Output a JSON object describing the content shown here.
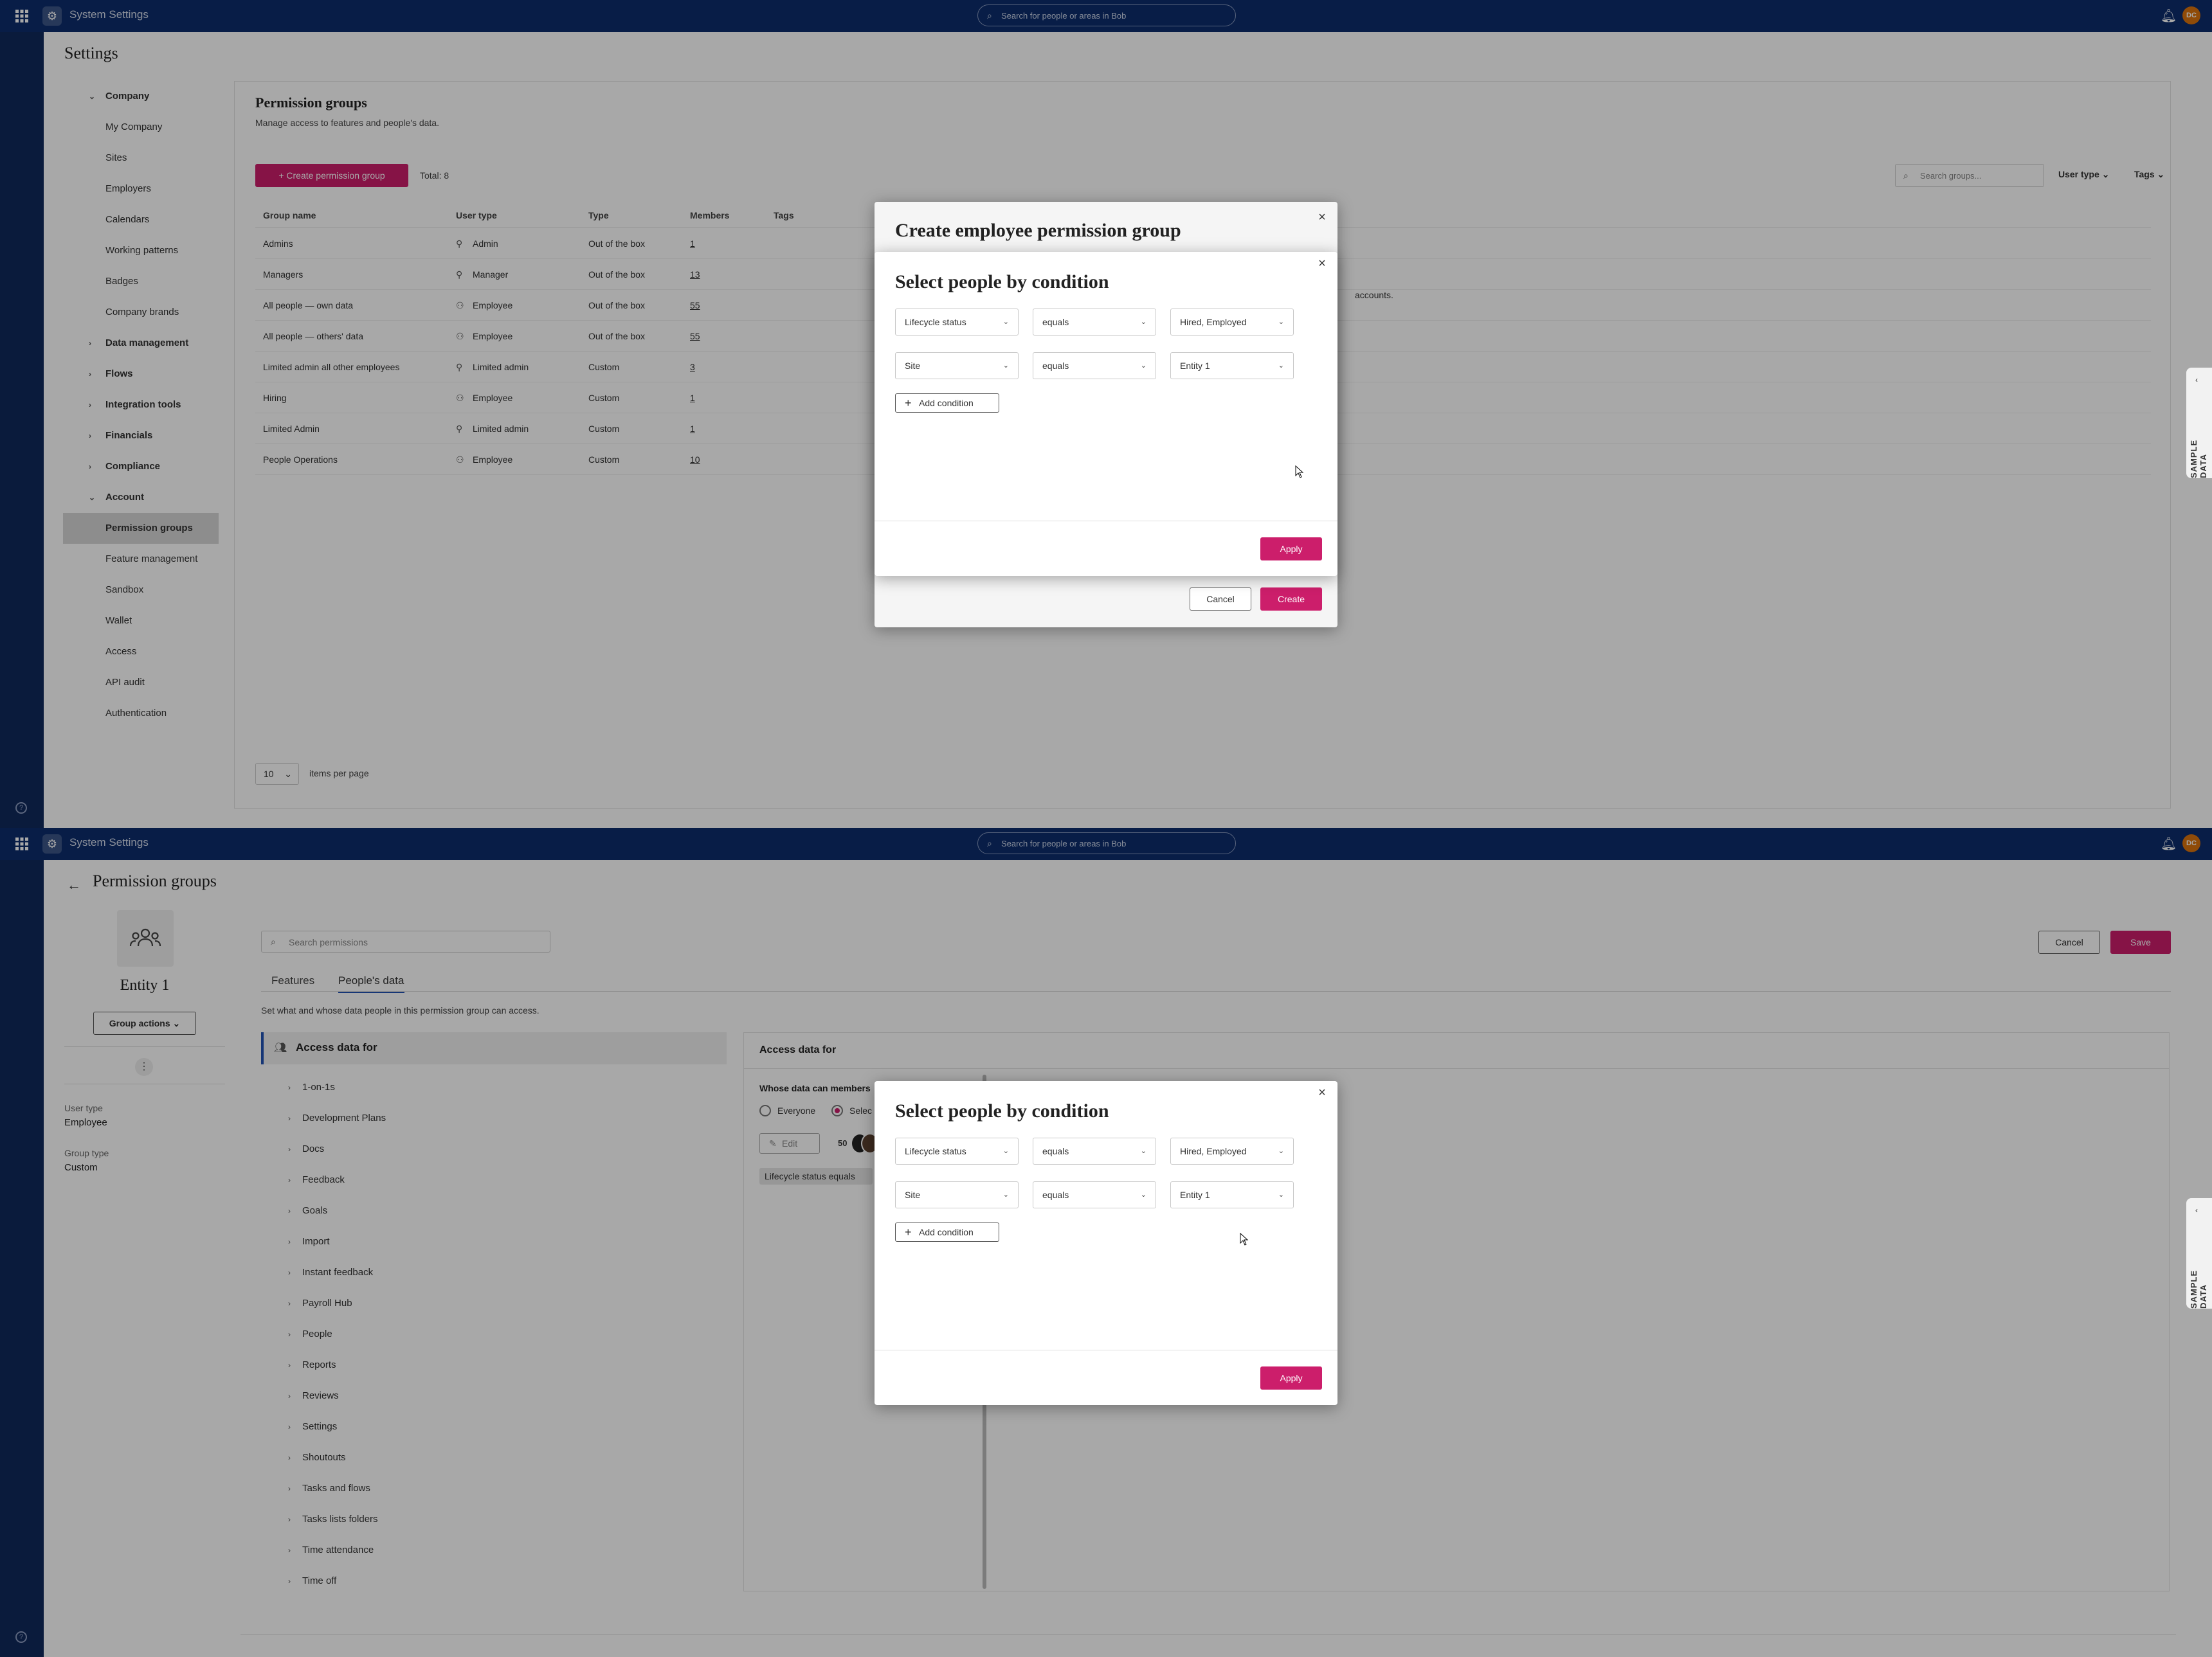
{
  "app": {
    "title": "System Settings",
    "search_placeholder": "Search for people or areas in Bob",
    "avatar_initials": "DC",
    "brand_color": "#0d2d6c",
    "accent_color": "#cc1e6b"
  },
  "settings": {
    "title": "Settings",
    "nav": [
      {
        "label": "Company",
        "type": "group",
        "expanded": true
      },
      {
        "label": "My Company",
        "type": "item"
      },
      {
        "label": "Sites",
        "type": "item"
      },
      {
        "label": "Employers",
        "type": "item"
      },
      {
        "label": "Calendars",
        "type": "item"
      },
      {
        "label": "Working patterns",
        "type": "item"
      },
      {
        "label": "Badges",
        "type": "item"
      },
      {
        "label": "Company brands",
        "type": "item"
      },
      {
        "label": "Data management",
        "type": "group",
        "expanded": false
      },
      {
        "label": "Flows",
        "type": "group",
        "expanded": false
      },
      {
        "label": "Integration tools",
        "type": "group",
        "expanded": false
      },
      {
        "label": "Financials",
        "type": "group",
        "expanded": false
      },
      {
        "label": "Compliance",
        "type": "group",
        "expanded": false
      },
      {
        "label": "Account",
        "type": "group",
        "expanded": true
      },
      {
        "label": "Permission groups",
        "type": "item",
        "active": true
      },
      {
        "label": "Feature management",
        "type": "item"
      },
      {
        "label": "Sandbox",
        "type": "item"
      },
      {
        "label": "Wallet",
        "type": "item"
      },
      {
        "label": "Access",
        "type": "item"
      },
      {
        "label": "API audit",
        "type": "item"
      },
      {
        "label": "Authentication",
        "type": "item"
      }
    ]
  },
  "permission_groups": {
    "title": "Permission groups",
    "subtitle": "Manage access to features and people's data.",
    "create_label": "Create permission group",
    "total": "Total: 8",
    "search_placeholder": "Search groups...",
    "filter_user_type": "User type",
    "filter_tags": "Tags",
    "columns": [
      "Group name",
      "User type",
      "Type",
      "Members",
      "Tags"
    ],
    "rows": [
      {
        "name": "Admins",
        "user_type": "Admin",
        "type": "Out of the box",
        "members": "1"
      },
      {
        "name": "Managers",
        "user_type": "Manager",
        "type": "Out of the box",
        "members": "13"
      },
      {
        "name": "All people — own data",
        "user_type": "Employee",
        "type": "Out of the box",
        "members": "55"
      },
      {
        "name": "All people — others' data",
        "user_type": "Employee",
        "type": "Out of the box",
        "members": "55"
      },
      {
        "name": "Limited admin all other employees",
        "user_type": "Limited admin",
        "type": "Custom",
        "members": "3"
      },
      {
        "name": "Hiring",
        "user_type": "Employee",
        "type": "Custom",
        "members": "1"
      },
      {
        "name": "Limited Admin",
        "user_type": "Limited admin",
        "type": "Custom",
        "members": "1"
      },
      {
        "name": "People Operations",
        "user_type": "Employee",
        "type": "Custom",
        "members": "10"
      }
    ],
    "partial_text": "accounts.",
    "per_page_value": "10",
    "per_page_label": "items per page"
  },
  "sample_data_label": "SAMPLE DATA",
  "create_modal": {
    "title": "Create employee permission group",
    "cancel_label": "Cancel",
    "create_label": "Create"
  },
  "condition_modal": {
    "title": "Select people by condition",
    "conditions": [
      {
        "field": "Lifecycle status",
        "operator": "equals",
        "value": "Hired, Employed"
      },
      {
        "field": "Site",
        "operator": "equals",
        "value": "Entity 1"
      }
    ],
    "add_condition_label": "Add condition",
    "apply_label": "Apply"
  },
  "group_detail": {
    "back_title": "Permission groups",
    "entity_name": "Entity 1",
    "group_actions_label": "Group actions",
    "user_type_label": "User type",
    "user_type_value": "Employee",
    "group_type_label": "Group type",
    "group_type_value": "Custom",
    "search_placeholder": "Search permissions",
    "tabs": [
      {
        "label": "Features",
        "active": false
      },
      {
        "label": "People's data",
        "active": true
      }
    ],
    "description": "Set what and whose data people in this permission group can access.",
    "access_data_for_label": "Access data for",
    "categories": [
      "1-on-1s",
      "Development Plans",
      "Docs",
      "Feedback",
      "Goals",
      "Import",
      "Instant feedback",
      "Payroll Hub",
      "People",
      "Reports",
      "Reviews",
      "Settings",
      "Shoutouts",
      "Tasks and flows",
      "Tasks lists folders",
      "Time attendance",
      "Time off"
    ],
    "right_panel": {
      "title": "Access data for",
      "question": "Whose data can members",
      "radio_everyone": "Everyone",
      "radio_select": "Selec",
      "edit_label": "Edit",
      "count": "50",
      "condition_chip": "Lifecycle status equals"
    },
    "cancel_label": "Cancel",
    "save_label": "Save"
  }
}
